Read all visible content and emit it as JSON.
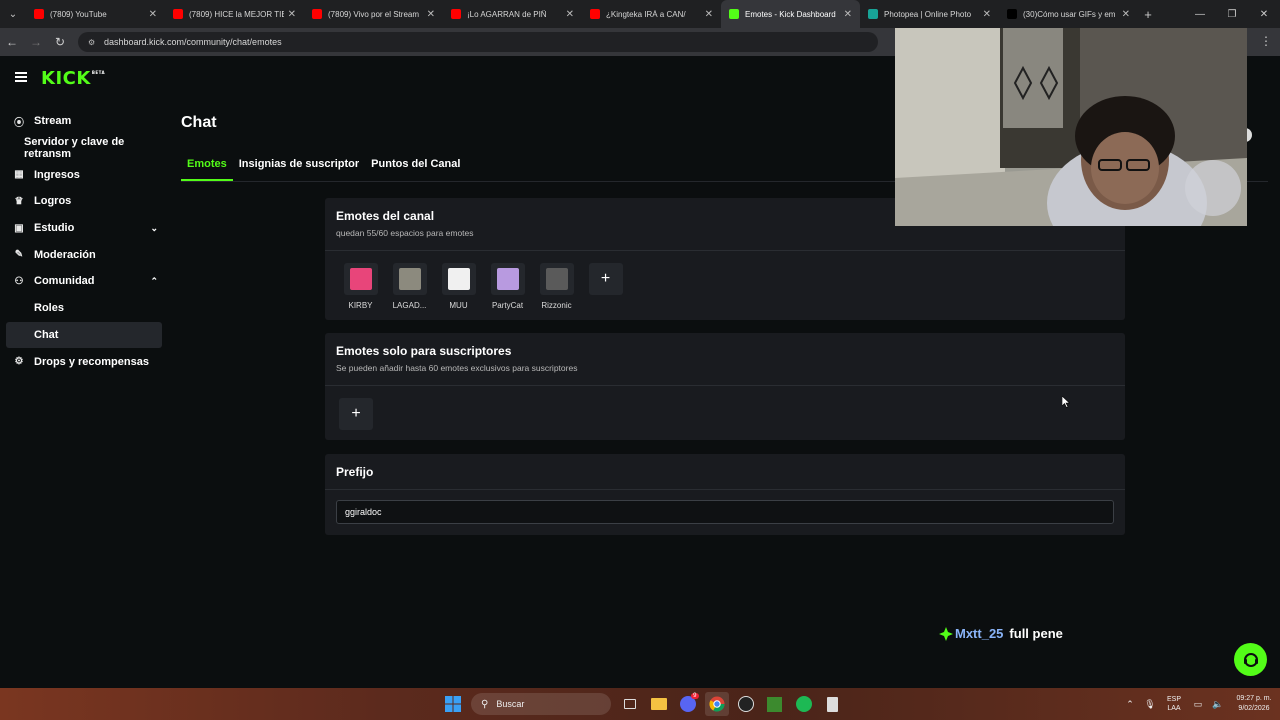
{
  "browser": {
    "tabs": [
      {
        "title": "(7809) YouTube",
        "color": "#ff0000"
      },
      {
        "title": "(7809) HICE la MEJOR TIE",
        "color": "#ff0000"
      },
      {
        "title": "(7809) Vivo por el Stream",
        "color": "#ff0000"
      },
      {
        "title": "¡Lo AGARRAN de PIÑ",
        "color": "#ff0000"
      },
      {
        "title": "¿Kingteka IRÁ a CAN/",
        "color": "#ff0000"
      },
      {
        "title": "Emotes - Kick Dashboard",
        "color": "#53fc18"
      },
      {
        "title": "Photopea | Online Photo",
        "color": "#18a497"
      },
      {
        "title": "(30)Cómo usar GIFs y em",
        "color": "#000000"
      }
    ],
    "url": "dashboard.kick.com/community/chat/emotes"
  },
  "app": {
    "logo": "KICK",
    "logo_badge": "BETA",
    "sidebar": [
      {
        "label": "Stream",
        "icon": "broadcast-icon"
      },
      {
        "label": "Servidor y clave de retransm",
        "icon": ""
      },
      {
        "label": "Ingresos",
        "icon": "chart-icon"
      },
      {
        "label": "Logros",
        "icon": "trophy-icon"
      },
      {
        "label": "Estudio",
        "icon": "studio-icon"
      },
      {
        "label": "Moderación",
        "icon": "wrench-icon"
      },
      {
        "label": "Comunidad",
        "icon": "community-icon"
      },
      {
        "label": "Roles",
        "icon": ""
      },
      {
        "label": "Chat",
        "icon": ""
      },
      {
        "label": "Drops y recompensas",
        "icon": "drops-icon"
      }
    ],
    "page_title": "Chat",
    "tabs": [
      "Emotes",
      "Insignias de suscriptor",
      "Puntos del Canal"
    ],
    "channel_emotes": {
      "title": "Emotes del canal",
      "subtitle": "quedan 55/60 espacios para emotes",
      "emotes": [
        {
          "name": "KIRBY",
          "color": "#e8457a"
        },
        {
          "name": "LAGAD...",
          "color": "#8c8a7e"
        },
        {
          "name": "MUU",
          "color": "#f0f0f0"
        },
        {
          "name": "PartyCat",
          "color": "#b89ae0"
        },
        {
          "name": "Rizzonic",
          "color": "#5a5a5a"
        }
      ],
      "add_label": "+"
    },
    "sub_emotes": {
      "title": "Emotes solo para suscriptores",
      "subtitle": "Se pueden añadir hasta 60 emotes exclusivos para suscriptores",
      "add_label": "+"
    },
    "prefix": {
      "title": "Prefijo",
      "value": "ggiraldoc"
    }
  },
  "overlay": {
    "chat_user": "Mxtt_25",
    "chat_message": "full pene"
  },
  "taskbar": {
    "search_label": "Buscar",
    "badge_count": "9",
    "lang_top": "ESP",
    "lang_bottom": "LAA",
    "time": "09:27 p. m.",
    "date": "9/02/2026"
  },
  "colors": {
    "kick_green": "#53fc18",
    "panel_bg": "#191b1f",
    "page_bg": "#0b0e0f"
  }
}
